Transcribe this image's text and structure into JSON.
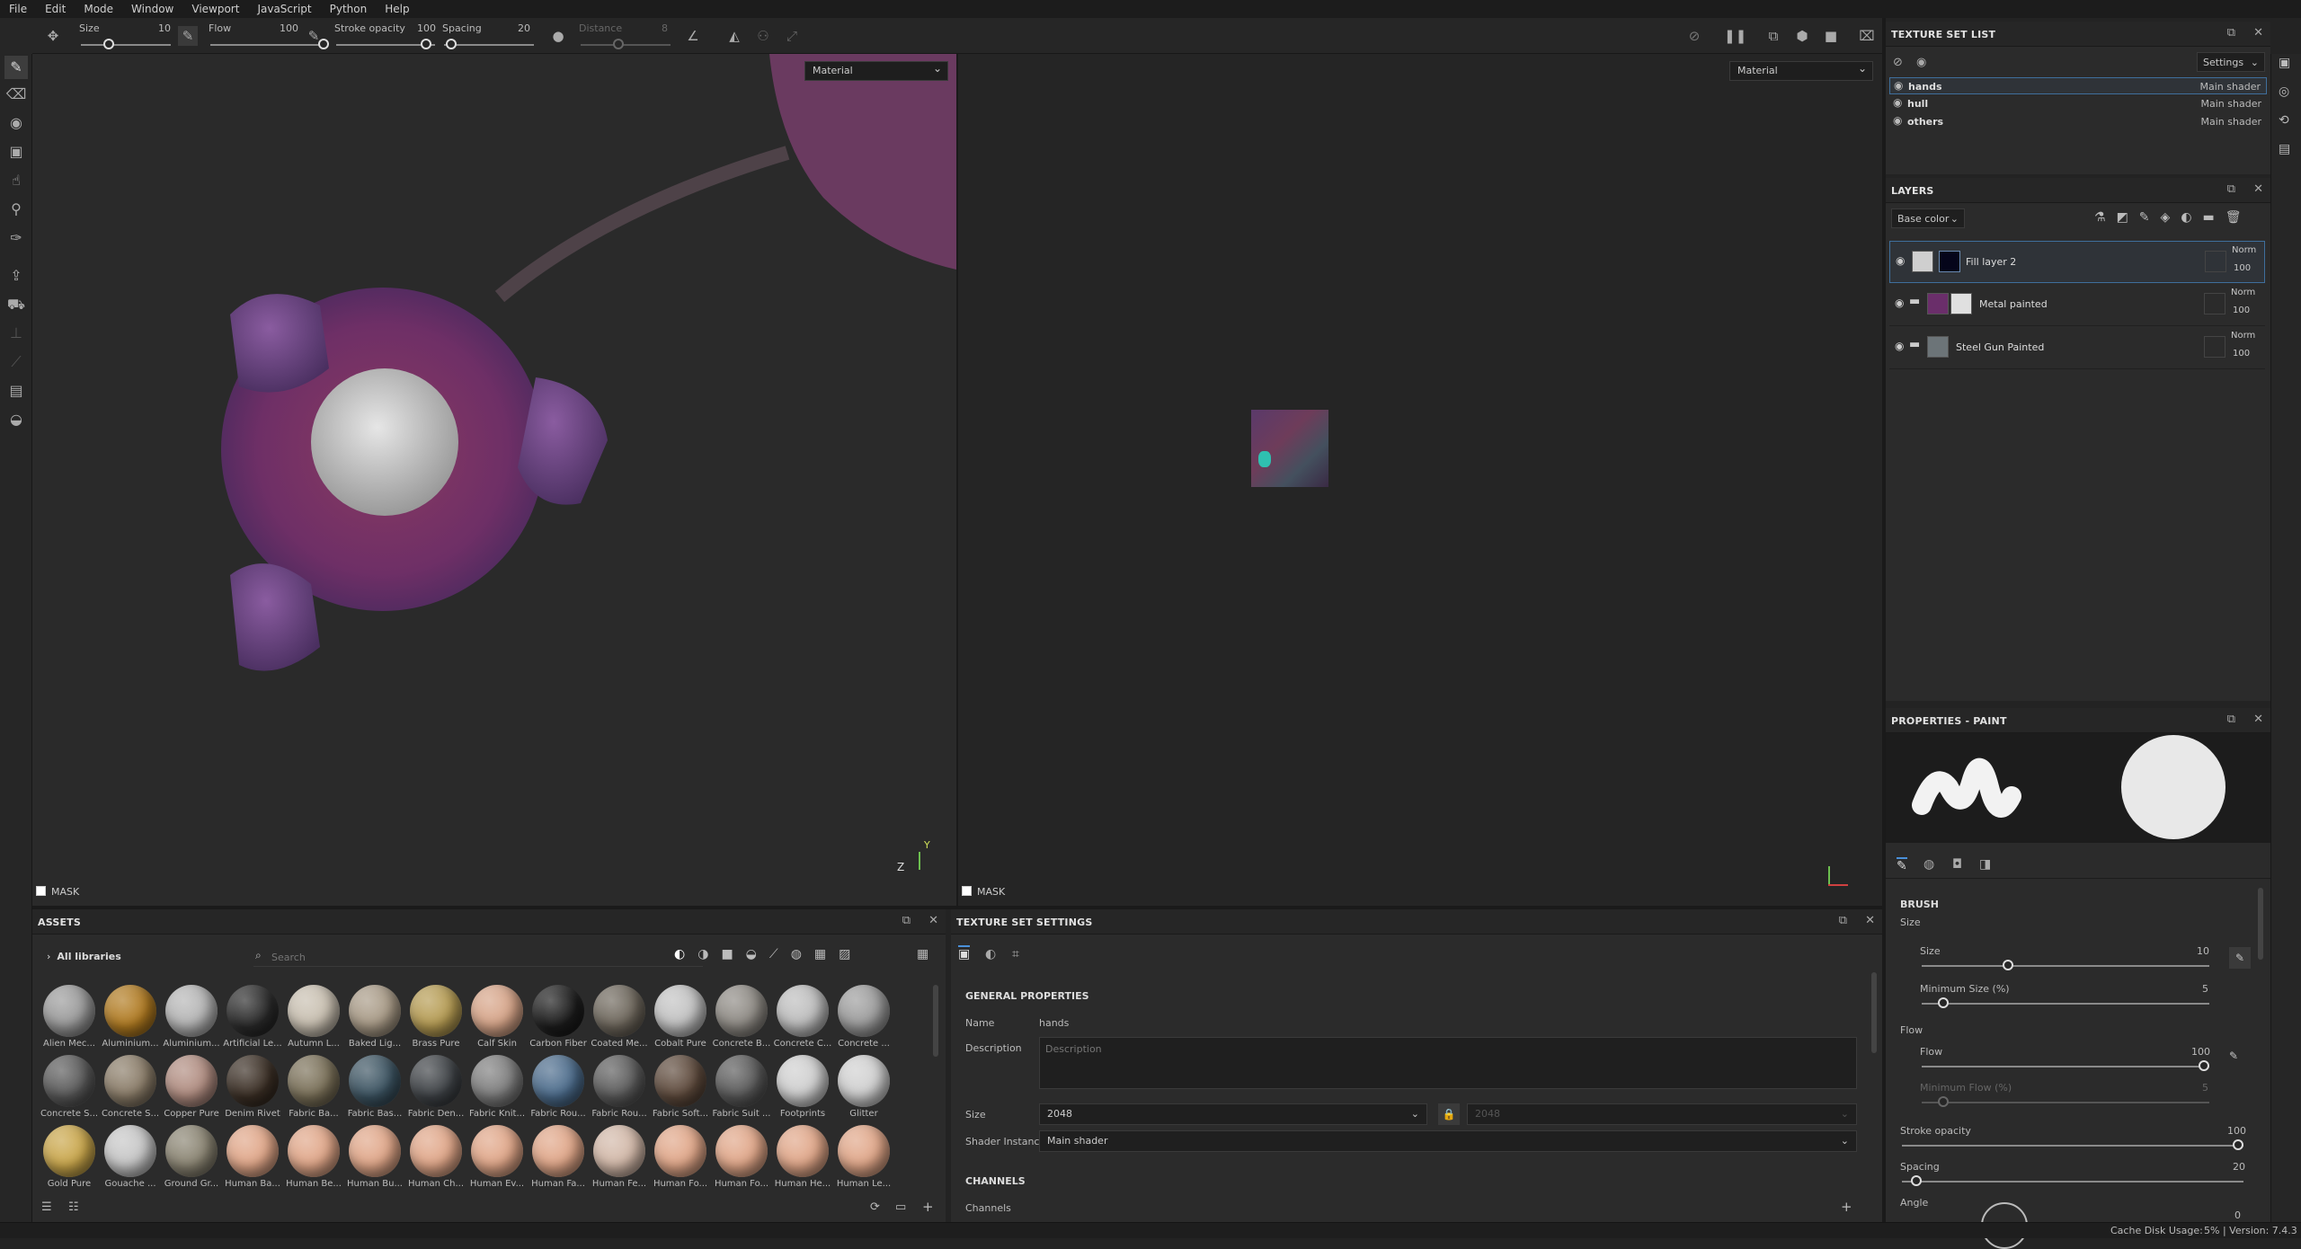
{
  "menu": [
    "File",
    "Edit",
    "Mode",
    "Window",
    "Viewport",
    "JavaScript",
    "Python",
    "Help"
  ],
  "toolbar": {
    "size_label": "Size",
    "size_value": "10",
    "flow_label": "Flow",
    "flow_value": "100",
    "stroke_opacity_label": "Stroke opacity",
    "stroke_opacity_value": "100",
    "spacing_label": "Spacing",
    "spacing_value": "20",
    "distance_label": "Distance",
    "distance_value": "8"
  },
  "viewport3d": {
    "mode": "Material",
    "mask_label": "MASK",
    "axis_z": "Z",
    "axis_y": "Y"
  },
  "viewport2d": {
    "mode": "Material",
    "mask_label": "MASK"
  },
  "texture_set_list": {
    "title": "TEXTURE SET LIST",
    "settings": "Settings",
    "rows": [
      {
        "name": "hands",
        "shader": "Main shader"
      },
      {
        "name": "hull",
        "shader": "Main shader"
      },
      {
        "name": "others",
        "shader": "Main shader"
      }
    ]
  },
  "layers": {
    "title": "LAYERS",
    "channel": "Base color",
    "rows": [
      {
        "name": "Fill layer 2",
        "blend": "Norm",
        "opacity": "100"
      },
      {
        "name": "Metal painted",
        "blend": "Norm",
        "opacity": "100"
      },
      {
        "name": "Steel Gun Painted",
        "blend": "Norm",
        "opacity": "100"
      }
    ]
  },
  "properties": {
    "title": "PROPERTIES - PAINT",
    "brush_section": "BRUSH",
    "size_group": "Size",
    "size_label": "Size",
    "size_value": "10",
    "min_size_label": "Minimum Size (%)",
    "min_size_value": "5",
    "flow_group": "Flow",
    "flow_label": "Flow",
    "flow_value": "100",
    "min_flow_label": "Minimum Flow (%)",
    "min_flow_value": "5",
    "stroke_opacity_label": "Stroke opacity",
    "stroke_opacity_value": "100",
    "spacing_label": "Spacing",
    "spacing_value": "20",
    "angle_label": "Angle",
    "angle_value": "0"
  },
  "assets": {
    "title": "ASSETS",
    "library": "All libraries",
    "search_placeholder": "Search",
    "items": [
      {
        "name": "Alien Mec...",
        "color": "#9a9a9a"
      },
      {
        "name": "Aluminium...",
        "color": "#b07a20"
      },
      {
        "name": "Aluminium...",
        "color": "#b5b5b5"
      },
      {
        "name": "Artificial Le...",
        "color": "#2a2a2a"
      },
      {
        "name": "Autumn L...",
        "color": "#c8bfb0"
      },
      {
        "name": "Baked Lig...",
        "color": "#a89a86"
      },
      {
        "name": "Brass Pure",
        "color": "#b59b52"
      },
      {
        "name": "Calf Skin",
        "color": "#d6a488"
      },
      {
        "name": "Carbon Fiber",
        "color": "#1c1c1c"
      },
      {
        "name": "Coated Me...",
        "color": "#6e675c"
      },
      {
        "name": "Cobalt Pure",
        "color": "#c2c2c2"
      },
      {
        "name": "Concrete B...",
        "color": "#8e8a84"
      },
      {
        "name": "Concrete C...",
        "color": "#bdbdbd"
      },
      {
        "name": "Concrete ...",
        "color": "#9c9c9c"
      },
      {
        "name": "Concrete S...",
        "color": "#5a5a5a"
      },
      {
        "name": "Concrete S...",
        "color": "#8a7c68"
      },
      {
        "name": "Copper Pure",
        "color": "#b08c80"
      },
      {
        "name": "Denim Rivet",
        "color": "#3a2e24"
      },
      {
        "name": "Fabric Ba...",
        "color": "#7a7058"
      },
      {
        "name": "Fabric Bas...",
        "color": "#3c5462"
      },
      {
        "name": "Fabric Den...",
        "color": "#3e4246"
      },
      {
        "name": "Fabric Knit...",
        "color": "#7e7e7e"
      },
      {
        "name": "Fabric Rou...",
        "color": "#4c6c8c"
      },
      {
        "name": "Fabric Rou...",
        "color": "#5c5c5c"
      },
      {
        "name": "Fabric Soft...",
        "color": "#5e4a3c"
      },
      {
        "name": "Fabric Suit ...",
        "color": "#5a5a5a"
      },
      {
        "name": "Footprints",
        "color": "#cfcfcf"
      },
      {
        "name": "Glitter",
        "color": "#d0d0d0"
      },
      {
        "name": "Gold Pure",
        "color": "#c9a64a"
      },
      {
        "name": "Gouache ...",
        "color": "#c6c6c6"
      },
      {
        "name": "Ground Gr...",
        "color": "#8a8472"
      },
      {
        "name": "Human Ba...",
        "color": "#e0a688"
      },
      {
        "name": "Human Be...",
        "color": "#e0a688"
      },
      {
        "name": "Human Bu...",
        "color": "#e0a688"
      },
      {
        "name": "Human Ch...",
        "color": "#e0a688"
      },
      {
        "name": "Human Ev...",
        "color": "#e0a688"
      },
      {
        "name": "Human Fa...",
        "color": "#e0a688"
      },
      {
        "name": "Human Fe...",
        "color": "#d2b8a8"
      },
      {
        "name": "Human Fo...",
        "color": "#e0a688"
      },
      {
        "name": "Human Fo...",
        "color": "#e0a688"
      },
      {
        "name": "Human He...",
        "color": "#e0a688"
      },
      {
        "name": "Human Le...",
        "color": "#e0a688"
      }
    ]
  },
  "texture_set_settings": {
    "title": "TEXTURE SET SETTINGS",
    "general": "GENERAL PROPERTIES",
    "name_label": "Name",
    "name_value": "hands",
    "description_label": "Description",
    "description_placeholder": "Description",
    "size_label": "Size",
    "size_value": "2048",
    "size_value2": "2048",
    "shader_label": "Shader Instance",
    "shader_value": "Main shader",
    "channels_section": "CHANNELS",
    "channels_label": "Channels"
  },
  "status": {
    "cache": "Cache Disk Usage:",
    "usage": "5% | Version: 7.4.3"
  }
}
